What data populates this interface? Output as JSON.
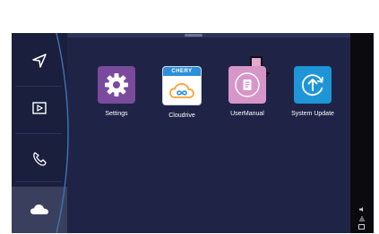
{
  "colors": {
    "screen_bg": "#1f2447",
    "sidebar_bg": "#1a1f3d",
    "settings_tile": "#7a4a9c",
    "cloudrive_tile": "#2d8fd8",
    "usermanual_tile": "#d696c8",
    "system_update_tile": "#1e95d6",
    "arrow_fill": "#e8a6d2"
  },
  "sidebar": {
    "items": [
      {
        "icon": "navigation-arrow-icon"
      },
      {
        "icon": "media-play-icon"
      },
      {
        "icon": "phone-icon"
      },
      {
        "icon": "cloud-icon",
        "active": true
      }
    ]
  },
  "apps": [
    {
      "label": "Settings",
      "icon": "gear-icon"
    },
    {
      "label": "Cloudrive",
      "icon": "cloud-infinity-icon",
      "brand": "CHERY"
    },
    {
      "label": "UserManual",
      "icon": "manual-icon"
    },
    {
      "label": "System Update",
      "icon": "update-arrow-icon"
    }
  ],
  "indicator": {
    "icon": "down-arrow-icon"
  }
}
